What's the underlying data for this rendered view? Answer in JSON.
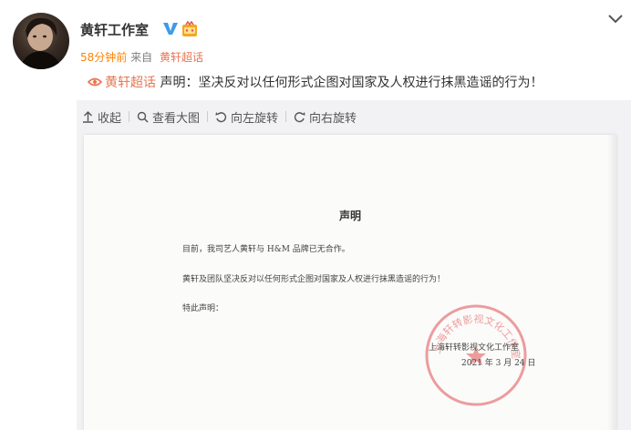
{
  "post": {
    "poster_name": "黄轩工作室",
    "time": "58分钟前",
    "from_label": "来自",
    "source": "黄轩超话",
    "topic_link": "黄轩超话",
    "text": " 声明：坚决反对以任何形式企图对国家及人权进行抹黑造谣的行为！"
  },
  "toolbar": {
    "collapse": "收起",
    "view_large": "查看大图",
    "rotate_left": "向左旋转",
    "rotate_right": "向右旋转"
  },
  "document": {
    "title": "声明",
    "line1": "目前，我司艺人黄轩与 H&M 品牌已无合作。",
    "line2": "黄轩及团队坚决反对以任何形式企图对国家及人权进行抹黑造谣的行为！",
    "line3": "特此声明：",
    "signature": "上海轩转影视文化工作室",
    "date": "2021 年 3 月 24 日",
    "seal_text": "上海轩转影视文化工作室"
  },
  "colors": {
    "accent_orange": "#eb7350",
    "time_orange": "#ff8200",
    "verified_blue": "#3d9be9",
    "seal_red": "#e05050"
  },
  "icons": {
    "verified": "verified-v-icon",
    "vip": "vip-badge-icon",
    "expand": "chevron-down-icon",
    "topic": "eye-diamond-icon",
    "collapse": "collapse-arrow-icon",
    "view_large": "magnifier-icon",
    "rotate_left": "rotate-left-icon",
    "rotate_right": "rotate-right-icon"
  }
}
